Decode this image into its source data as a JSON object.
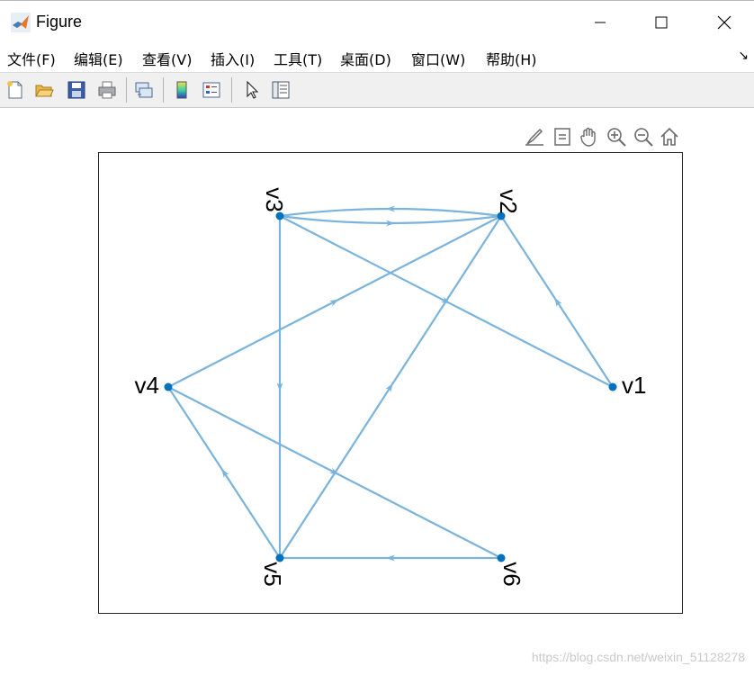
{
  "window": {
    "title": "Figure",
    "app_icon": "matlab-logo-icon"
  },
  "menu": [
    {
      "label": "文件(F)"
    },
    {
      "label": "编辑(E)"
    },
    {
      "label": "查看(V)"
    },
    {
      "label": "插入(I)"
    },
    {
      "label": "工具(T)"
    },
    {
      "label": "桌面(D)"
    },
    {
      "label": "窗口(W)"
    },
    {
      "label": "帮助(H)"
    }
  ],
  "toolbar": [
    "new-figure-icon",
    "open-file-icon",
    "save-icon",
    "print-icon",
    "link-plot-icon",
    "insert-colorbar-icon",
    "insert-legend-icon",
    "edit-plot-cursor-icon",
    "property-inspector-icon"
  ],
  "axes_toolbar": [
    "brush-icon",
    "data-tips-icon",
    "pan-hand-icon",
    "zoom-in-icon",
    "zoom-out-icon",
    "restore-view-home-icon"
  ],
  "colors": {
    "edge": "#7ab3dc",
    "node": "#0072bd",
    "label": "#000000"
  },
  "chart_data": {
    "type": "digraph",
    "nodes": [
      {
        "name": "v1"
      },
      {
        "name": "v2"
      },
      {
        "name": "v3"
      },
      {
        "name": "v4"
      },
      {
        "name": "v5"
      },
      {
        "name": "v6"
      }
    ],
    "edges": [
      {
        "source": "v1",
        "target": "v2"
      },
      {
        "source": "v3",
        "target": "v1"
      },
      {
        "source": "v3",
        "target": "v2"
      },
      {
        "source": "v2",
        "target": "v3"
      },
      {
        "source": "v3",
        "target": "v5"
      },
      {
        "source": "v4",
        "target": "v2"
      },
      {
        "source": "v5",
        "target": "v2"
      },
      {
        "source": "v5",
        "target": "v4"
      },
      {
        "source": "v4",
        "target": "v6"
      },
      {
        "source": "v6",
        "target": "v5"
      }
    ]
  },
  "watermark": "https://blog.csdn.net/weixin_51128278"
}
